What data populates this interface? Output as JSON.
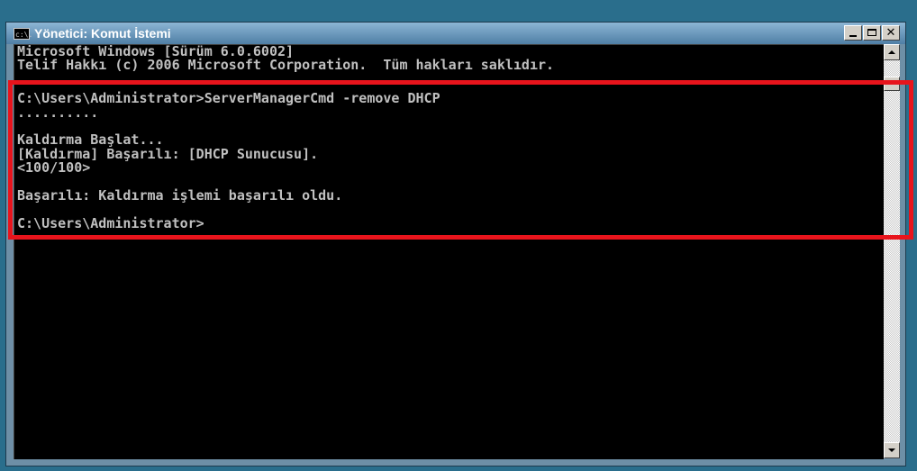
{
  "window": {
    "title": "Yönetici: Komut İstemi",
    "icon_text": "c:\\."
  },
  "console": {
    "lines": [
      "Microsoft Windows [Sürüm 6.0.6002]",
      "Telif Hakkı (c) 2006 Microsoft Corporation.  Tüm hakları saklıdır.",
      "",
      "C:\\Users\\Administrator>ServerManagerCmd -remove DHCP",
      "..........",
      "",
      "Kaldırma Başlat...",
      "[Kaldırma] Başarılı: [DHCP Sunucusu].",
      "<100/100>",
      "",
      "Başarılı: Kaldırma işlemi başarılı oldu.",
      "",
      "C:\\Users\\Administrator>"
    ]
  },
  "colors": {
    "highlight": "#e8141c",
    "console_bg": "#000000",
    "console_text": "#c0c0c0"
  }
}
